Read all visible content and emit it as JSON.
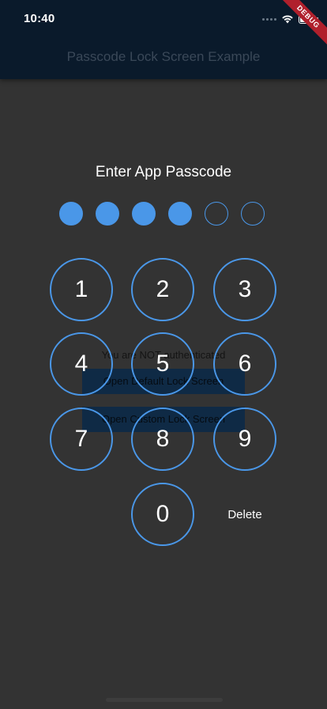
{
  "status_bar": {
    "time": "10:40",
    "icons": [
      "cellular-signal-icon",
      "wifi-icon",
      "battery-icon"
    ]
  },
  "app_bar": {
    "title": "Passcode Lock Screen Example",
    "debug_banner": "DEBUG"
  },
  "underlying_page": {
    "auth_status": "You are NOT authenticated",
    "open_default_label": "Open Default Lock Screen",
    "open_custom_label": "Open Custom Lock Screen"
  },
  "lock_screen": {
    "title": "Enter App Passcode",
    "passcode_length": 6,
    "digits_entered": 4,
    "keys": [
      "1",
      "2",
      "3",
      "4",
      "5",
      "6",
      "7",
      "8",
      "9",
      "0"
    ],
    "delete_label": "Delete"
  },
  "colors": {
    "accent": "#4a97e8",
    "background": "#333333",
    "app_bar": "#0a1a2b",
    "debug_ribbon": "#b0202c"
  }
}
